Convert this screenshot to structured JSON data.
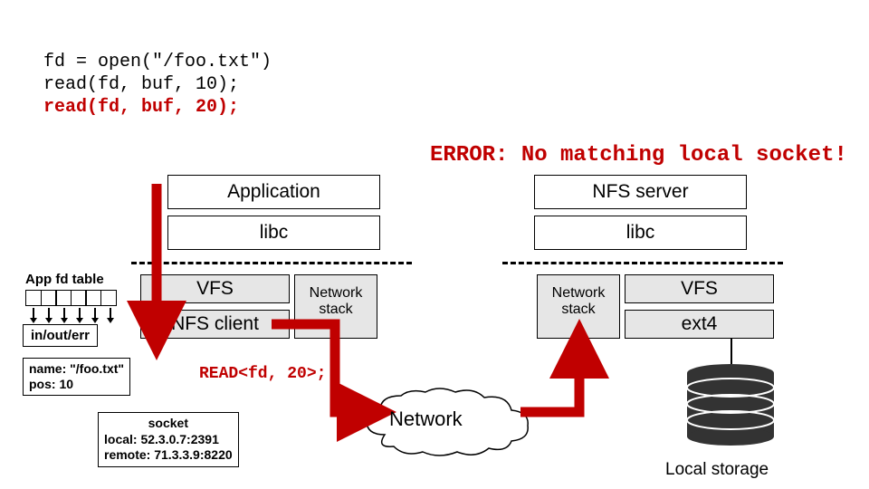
{
  "code": {
    "line1": "fd = open(\"/foo.txt\")",
    "line2": "read(fd, buf, 10);",
    "line3": "read(fd, buf, 20);"
  },
  "error": "ERROR: No matching local socket!",
  "left_stack": {
    "application": "Application",
    "libc": "libc",
    "vfs": "VFS",
    "nfs_client": "NFS client",
    "network_stack": "Network\nstack"
  },
  "right_stack": {
    "nfs_server": "NFS server",
    "libc": "libc",
    "vfs": "VFS",
    "ext4": "ext4",
    "network_stack": "Network\nstack"
  },
  "fd_table": {
    "label": "App fd table",
    "in_out_err": "in/out/err",
    "name_label": "name: \"/foo.txt\"",
    "pos_label": "pos: 10"
  },
  "read_cmd": "READ<fd, 20>;",
  "socket": {
    "title": "socket",
    "local": "local:    52.3.0.7:2391",
    "remote": "remote: 71.3.3.9:8220"
  },
  "network": "Network",
  "storage_label": "Local storage"
}
